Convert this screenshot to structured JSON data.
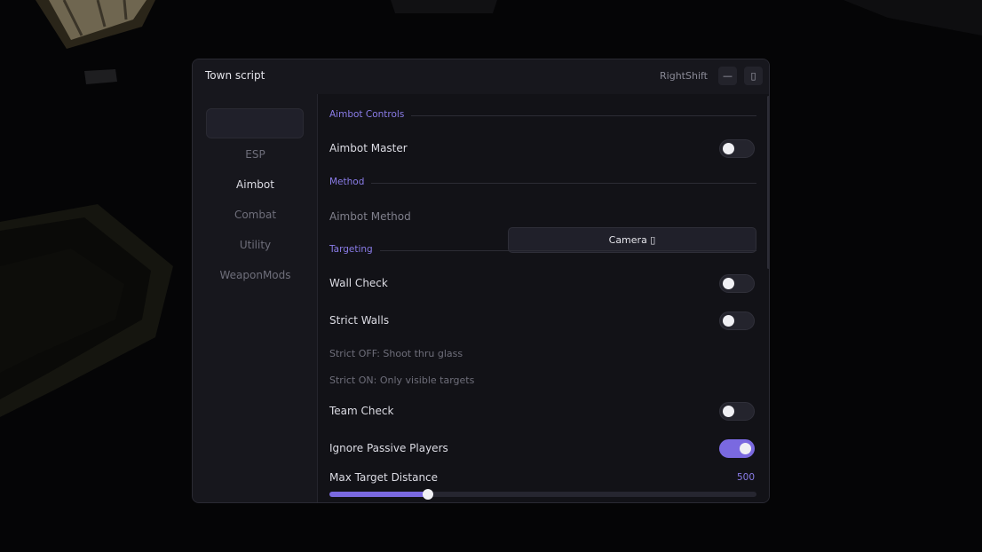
{
  "window": {
    "title": "Town script",
    "keybind": "RightShift",
    "minimize_glyph": "—",
    "close_glyph": "▯"
  },
  "sidebar": {
    "items": [
      {
        "label": "ESP",
        "active": false
      },
      {
        "label": "Aimbot",
        "active": true
      },
      {
        "label": "Combat",
        "active": false
      },
      {
        "label": "Utility",
        "active": false
      },
      {
        "label": "WeaponMods",
        "active": false
      }
    ]
  },
  "sections": {
    "aimbot_controls": "Aimbot Controls",
    "method": "Method",
    "targeting": "Targeting"
  },
  "controls": {
    "aimbot_master": {
      "label": "Aimbot Master",
      "on": false
    },
    "aimbot_method": {
      "label": "Aimbot Method",
      "value": "Camera ▯"
    },
    "wall_check": {
      "label": "Wall Check",
      "on": false
    },
    "strict_walls": {
      "label": "Strict Walls",
      "on": false
    },
    "hint_off": "Strict OFF: Shoot thru glass",
    "hint_on": "Strict ON: Only visible targets",
    "team_check": {
      "label": "Team Check",
      "on": false
    },
    "ignore_passive": {
      "label": "Ignore Passive Players",
      "on": true
    },
    "max_distance": {
      "label": "Max Target Distance",
      "value": "500",
      "fraction": 0.23
    }
  },
  "colors": {
    "accent": "#7a69e0",
    "section_text": "#8a7ce8"
  }
}
